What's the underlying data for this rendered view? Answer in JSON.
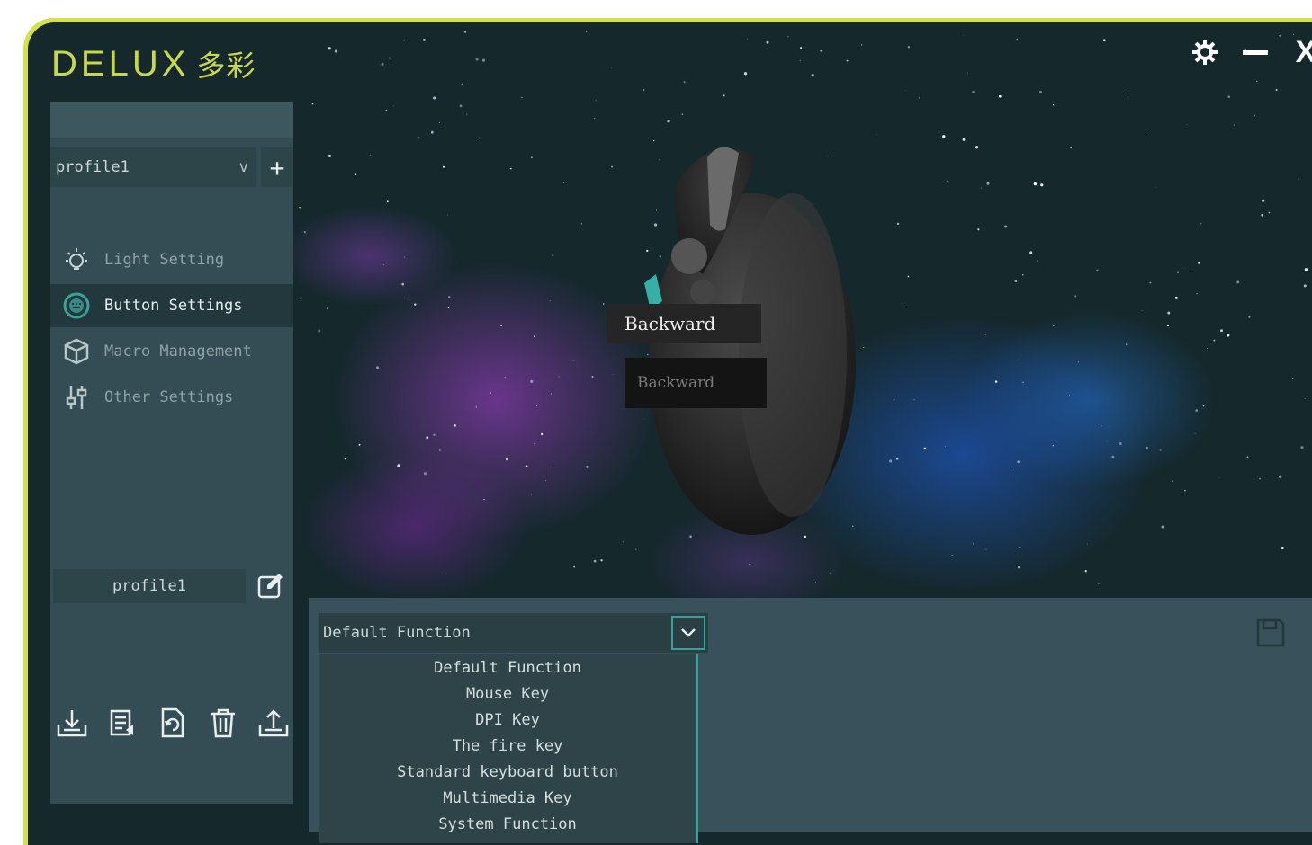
{
  "app": {
    "logo_latin": "DELUX",
    "logo_cjk": "多彩"
  },
  "window_controls": [
    {
      "name": "settings",
      "icon": "gear-icon"
    },
    {
      "name": "minimize",
      "icon": "minimize-icon"
    },
    {
      "name": "close",
      "icon": "close-icon",
      "label": "X"
    }
  ],
  "sidebar": {
    "profile_select": {
      "value": "profile1",
      "chevron": "v"
    },
    "add_label": "+",
    "nav": [
      {
        "label": "Light Setting",
        "icon": "light-bulb-icon",
        "active": false
      },
      {
        "label": "Button Settings",
        "icon": "button-settings-icon",
        "active": true
      },
      {
        "label": "Macro Management",
        "icon": "macro-cube-icon",
        "active": false
      },
      {
        "label": "Other Settings",
        "icon": "sliders-icon",
        "active": false
      }
    ],
    "profile_name": "profile1",
    "bottom_icons": [
      "import-icon",
      "export-list-icon",
      "refresh-icon",
      "trash-icon",
      "upload-icon"
    ]
  },
  "mouse_view": {
    "tooltip": "Backward",
    "tooltip_sub": "Backward"
  },
  "function_panel": {
    "selected": "Default Function",
    "options": [
      "Default Function",
      "Mouse Key",
      "DPI Key",
      "The fire key",
      "Standard keyboard button",
      "Multimedia Key",
      "System Function"
    ],
    "save_icon": "save-icon"
  },
  "colors": {
    "accent_yellow": "#c8d84a",
    "teal_highlight": "#3aa09a",
    "sidebar_bg": "#344d54",
    "panel_bg": "#38515a"
  }
}
